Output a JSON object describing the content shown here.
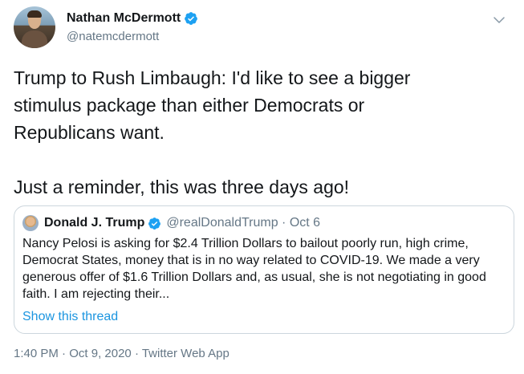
{
  "author": {
    "display_name": "Nathan McDermott",
    "handle": "@natemcdermott",
    "verified_icon": "verified-badge-icon"
  },
  "tweet": {
    "text": "Trump to Rush Limbaugh: I'd like to see a bigger\nstimulus package than either Democrats or\nRepublicans want.\n\nJust a reminder, this was three days ago!"
  },
  "quoted_tweet": {
    "display_name": "Donald J. Trump",
    "handle_and_date": "@realDonaldTrump · Oct 6",
    "text": "Nancy Pelosi is asking for $2.4 Trillion Dollars to bailout poorly run, high crime, Democrat States, money that is in no way related to COVID-19. We made a very generous offer of $1.6 Trillion Dollars and, as usual, she is not negotiating in good faith. I am rejecting their...",
    "show_thread_label": "Show this thread"
  },
  "meta": {
    "time": "1:40 PM",
    "separator": " · ",
    "date": "Oct 9, 2020",
    "source": "Twitter Web App"
  },
  "colors": {
    "link_blue": "#1b95e0",
    "verified_blue": "#1da1f2",
    "secondary_gray": "#657786",
    "border": "#ccd6dd"
  }
}
